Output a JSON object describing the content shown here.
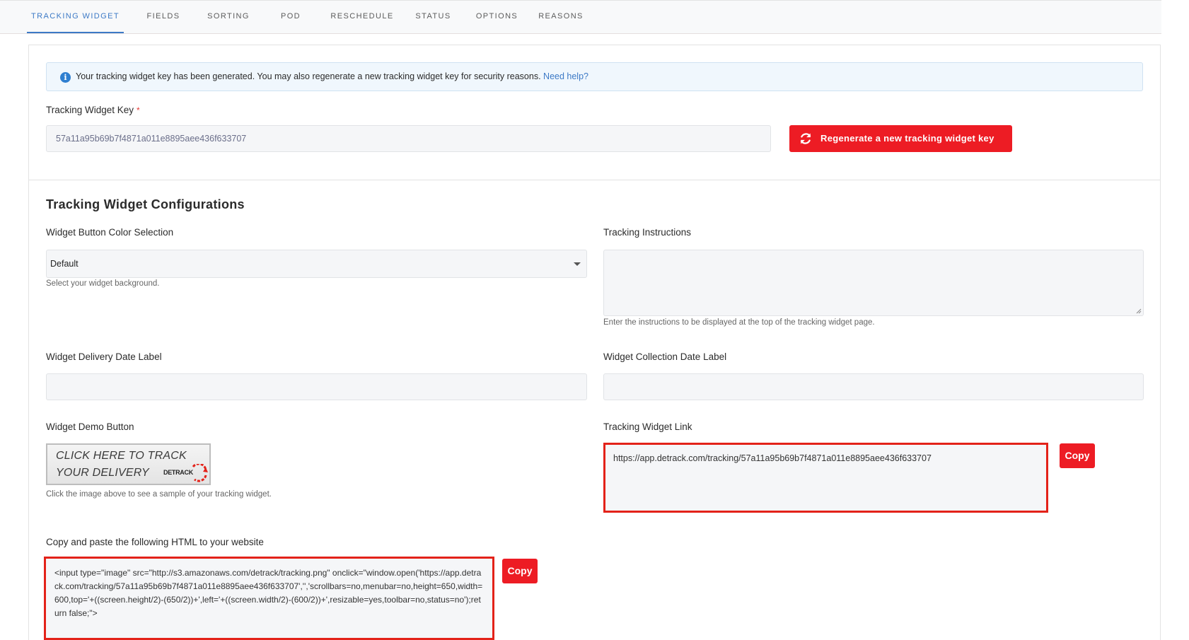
{
  "tabs": [
    {
      "label": "TRACKING WIDGET",
      "active": true
    },
    {
      "label": "FIELDS",
      "active": false
    },
    {
      "label": "SORTING",
      "active": false
    },
    {
      "label": "POD",
      "active": false
    },
    {
      "label": "RESCHEDULE",
      "active": false
    },
    {
      "label": "STATUS",
      "active": false
    },
    {
      "label": "OPTIONS",
      "active": false
    },
    {
      "label": "REASONS",
      "active": false
    }
  ],
  "alert": {
    "message": "Your tracking widget key has been generated. You may also regenerate a new tracking widget key for security reasons.",
    "help_link": "Need help?",
    "icon": "info-icon"
  },
  "key_section": {
    "label": "Tracking Widget Key",
    "required_mark": "*",
    "value": "57a11a95b69b7f4871a011e8895aee436f633707",
    "regenerate_button": "Regenerate a new tracking widget key",
    "regenerate_icon": "refresh-icon"
  },
  "config": {
    "title": "Tracking Widget Configurations",
    "button_color": {
      "label": "Widget Button Color Selection",
      "selected": "Default",
      "help": "Select your widget background."
    },
    "instructions": {
      "label": "Tracking Instructions",
      "value": "",
      "help": "Enter the instructions to be displayed at the top of the tracking widget page."
    },
    "delivery_date_label": {
      "label": "Widget Delivery Date Label",
      "value": ""
    },
    "collection_date_label": {
      "label": "Widget Collection Date Label",
      "value": ""
    },
    "demo_button": {
      "label": "Widget Demo Button",
      "line1": "CLICK HERE TO TRACK",
      "line2": "YOUR DELIVERY",
      "brand": "DETRACK",
      "help": "Click the image above to see a sample of your tracking widget."
    },
    "widget_link": {
      "label": "Tracking Widget Link",
      "value": "https://app.detrack.com/tracking/57a11a95b69b7f4871a011e8895aee436f633707",
      "copy_label": "Copy"
    },
    "embed_html": {
      "label": "Copy and paste the following HTML to your website",
      "value": "<input type=\"image\" src=\"http://s3.amazonaws.com/detrack/tracking.png\" onclick=\"window.open('https://app.detrack.com/tracking/57a11a95b69b7f4871a011e8895aee436f633707','','scrollbars=no,menubar=no,height=650,width=600,top='+((screen.height/2)-(650/2))+',left='+((screen.width/2)-(600/2))+',resizable=yes,toolbar=no,status=no');return false;\">",
      "copy_label": "Copy"
    }
  },
  "colors": {
    "accent": "#3d7ac6",
    "danger": "#ed1c24",
    "highlight_border": "#e32219"
  }
}
